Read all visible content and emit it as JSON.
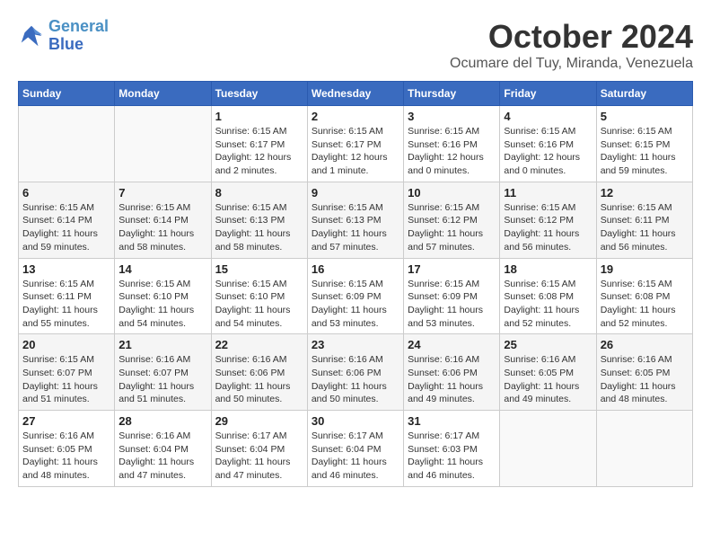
{
  "header": {
    "logo_line1": "General",
    "logo_line2": "Blue",
    "month_title": "October 2024",
    "location": "Ocumare del Tuy, Miranda, Venezuela"
  },
  "calendar": {
    "days_of_week": [
      "Sunday",
      "Monday",
      "Tuesday",
      "Wednesday",
      "Thursday",
      "Friday",
      "Saturday"
    ],
    "weeks": [
      [
        {
          "day": "",
          "info": ""
        },
        {
          "day": "",
          "info": ""
        },
        {
          "day": "1",
          "info": "Sunrise: 6:15 AM\nSunset: 6:17 PM\nDaylight: 12 hours\nand 2 minutes."
        },
        {
          "day": "2",
          "info": "Sunrise: 6:15 AM\nSunset: 6:17 PM\nDaylight: 12 hours\nand 1 minute."
        },
        {
          "day": "3",
          "info": "Sunrise: 6:15 AM\nSunset: 6:16 PM\nDaylight: 12 hours\nand 0 minutes."
        },
        {
          "day": "4",
          "info": "Sunrise: 6:15 AM\nSunset: 6:16 PM\nDaylight: 12 hours\nand 0 minutes."
        },
        {
          "day": "5",
          "info": "Sunrise: 6:15 AM\nSunset: 6:15 PM\nDaylight: 11 hours\nand 59 minutes."
        }
      ],
      [
        {
          "day": "6",
          "info": "Sunrise: 6:15 AM\nSunset: 6:14 PM\nDaylight: 11 hours\nand 59 minutes."
        },
        {
          "day": "7",
          "info": "Sunrise: 6:15 AM\nSunset: 6:14 PM\nDaylight: 11 hours\nand 58 minutes."
        },
        {
          "day": "8",
          "info": "Sunrise: 6:15 AM\nSunset: 6:13 PM\nDaylight: 11 hours\nand 58 minutes."
        },
        {
          "day": "9",
          "info": "Sunrise: 6:15 AM\nSunset: 6:13 PM\nDaylight: 11 hours\nand 57 minutes."
        },
        {
          "day": "10",
          "info": "Sunrise: 6:15 AM\nSunset: 6:12 PM\nDaylight: 11 hours\nand 57 minutes."
        },
        {
          "day": "11",
          "info": "Sunrise: 6:15 AM\nSunset: 6:12 PM\nDaylight: 11 hours\nand 56 minutes."
        },
        {
          "day": "12",
          "info": "Sunrise: 6:15 AM\nSunset: 6:11 PM\nDaylight: 11 hours\nand 56 minutes."
        }
      ],
      [
        {
          "day": "13",
          "info": "Sunrise: 6:15 AM\nSunset: 6:11 PM\nDaylight: 11 hours\nand 55 minutes."
        },
        {
          "day": "14",
          "info": "Sunrise: 6:15 AM\nSunset: 6:10 PM\nDaylight: 11 hours\nand 54 minutes."
        },
        {
          "day": "15",
          "info": "Sunrise: 6:15 AM\nSunset: 6:10 PM\nDaylight: 11 hours\nand 54 minutes."
        },
        {
          "day": "16",
          "info": "Sunrise: 6:15 AM\nSunset: 6:09 PM\nDaylight: 11 hours\nand 53 minutes."
        },
        {
          "day": "17",
          "info": "Sunrise: 6:15 AM\nSunset: 6:09 PM\nDaylight: 11 hours\nand 53 minutes."
        },
        {
          "day": "18",
          "info": "Sunrise: 6:15 AM\nSunset: 6:08 PM\nDaylight: 11 hours\nand 52 minutes."
        },
        {
          "day": "19",
          "info": "Sunrise: 6:15 AM\nSunset: 6:08 PM\nDaylight: 11 hours\nand 52 minutes."
        }
      ],
      [
        {
          "day": "20",
          "info": "Sunrise: 6:15 AM\nSunset: 6:07 PM\nDaylight: 11 hours\nand 51 minutes."
        },
        {
          "day": "21",
          "info": "Sunrise: 6:16 AM\nSunset: 6:07 PM\nDaylight: 11 hours\nand 51 minutes."
        },
        {
          "day": "22",
          "info": "Sunrise: 6:16 AM\nSunset: 6:06 PM\nDaylight: 11 hours\nand 50 minutes."
        },
        {
          "day": "23",
          "info": "Sunrise: 6:16 AM\nSunset: 6:06 PM\nDaylight: 11 hours\nand 50 minutes."
        },
        {
          "day": "24",
          "info": "Sunrise: 6:16 AM\nSunset: 6:06 PM\nDaylight: 11 hours\nand 49 minutes."
        },
        {
          "day": "25",
          "info": "Sunrise: 6:16 AM\nSunset: 6:05 PM\nDaylight: 11 hours\nand 49 minutes."
        },
        {
          "day": "26",
          "info": "Sunrise: 6:16 AM\nSunset: 6:05 PM\nDaylight: 11 hours\nand 48 minutes."
        }
      ],
      [
        {
          "day": "27",
          "info": "Sunrise: 6:16 AM\nSunset: 6:05 PM\nDaylight: 11 hours\nand 48 minutes."
        },
        {
          "day": "28",
          "info": "Sunrise: 6:16 AM\nSunset: 6:04 PM\nDaylight: 11 hours\nand 47 minutes."
        },
        {
          "day": "29",
          "info": "Sunrise: 6:17 AM\nSunset: 6:04 PM\nDaylight: 11 hours\nand 47 minutes."
        },
        {
          "day": "30",
          "info": "Sunrise: 6:17 AM\nSunset: 6:04 PM\nDaylight: 11 hours\nand 46 minutes."
        },
        {
          "day": "31",
          "info": "Sunrise: 6:17 AM\nSunset: 6:03 PM\nDaylight: 11 hours\nand 46 minutes."
        },
        {
          "day": "",
          "info": ""
        },
        {
          "day": "",
          "info": ""
        }
      ]
    ]
  }
}
